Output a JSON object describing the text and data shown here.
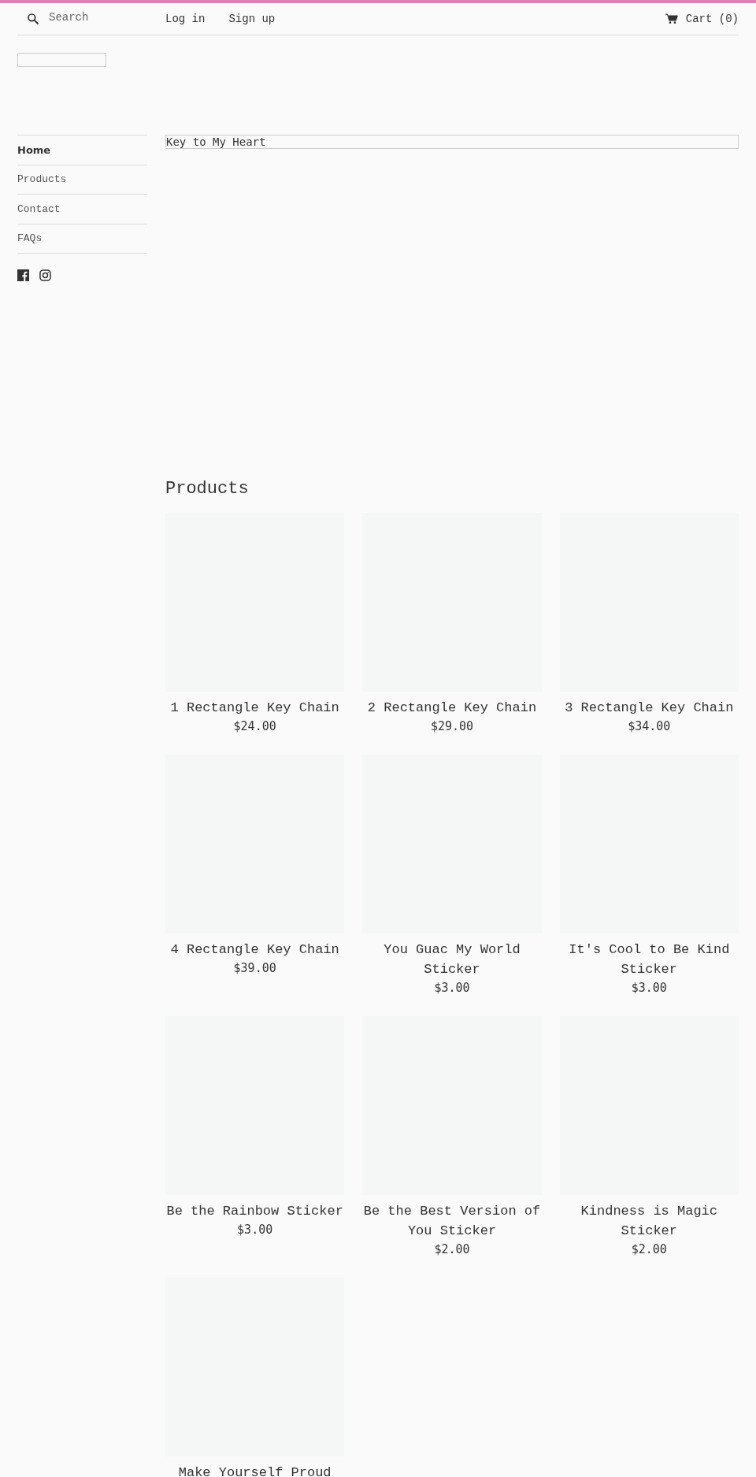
{
  "header": {
    "search": {
      "placeholder": "Search"
    },
    "links": [
      "Log in",
      "Sign up"
    ],
    "cart": "Cart (0)"
  },
  "sidebar": {
    "items": [
      {
        "label": "Home",
        "selected": true
      },
      {
        "label": "Products",
        "selected": false
      },
      {
        "label": "Contact",
        "selected": false
      },
      {
        "label": "FAQs",
        "selected": false
      }
    ]
  },
  "featured": {
    "title": "Key to My Heart"
  },
  "products": {
    "heading": "Products",
    "items": [
      {
        "title": "1 Rectangle Key Chain",
        "price": "$24.00"
      },
      {
        "title": "2 Rectangle Key Chain",
        "price": "$29.00"
      },
      {
        "title": "3 Rectangle Key Chain",
        "price": "$34.00"
      },
      {
        "title": "4 Rectangle Key Chain",
        "price": "$39.00"
      },
      {
        "title": "You Guac My World Sticker",
        "price": "$3.00"
      },
      {
        "title": "It's Cool to Be Kind Sticker",
        "price": "$3.00"
      },
      {
        "title": "Be the Rainbow Sticker",
        "price": "$3.00"
      },
      {
        "title": "Be the Best Version of You Sticker",
        "price": "$2.00"
      },
      {
        "title": "Kindness is Magic Sticker",
        "price": "$2.00"
      },
      {
        "title": "Make Yourself Proud"
      }
    ]
  }
}
